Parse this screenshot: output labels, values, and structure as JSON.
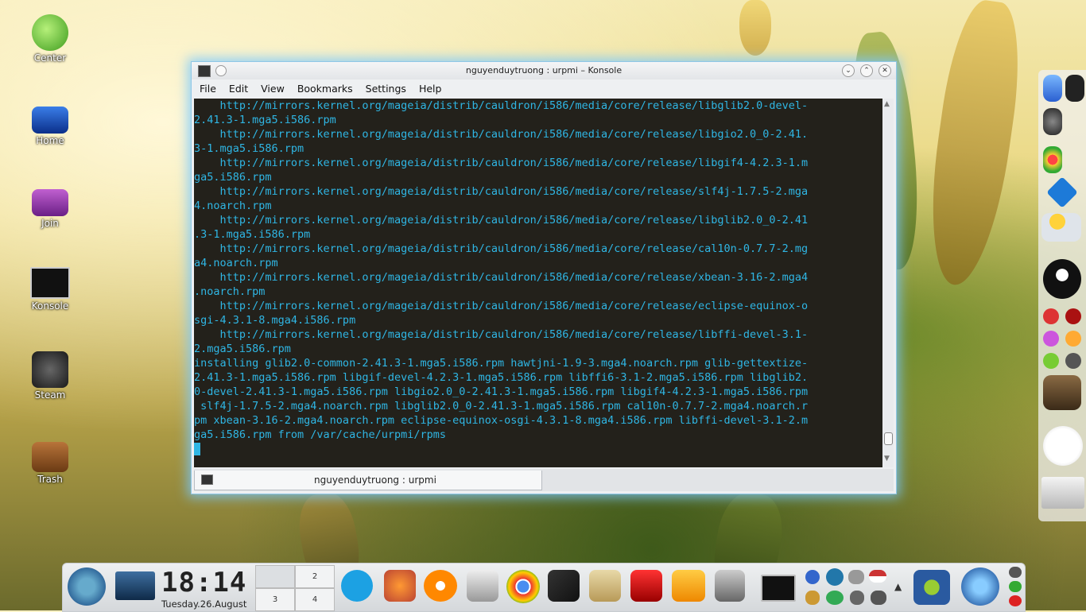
{
  "window": {
    "title": "nguyenduytruong : urpmi – Konsole",
    "menu": [
      "File",
      "Edit",
      "View",
      "Bookmarks",
      "Settings",
      "Help"
    ],
    "tab_label": "nguyenduytruong : urpmi"
  },
  "terminal": {
    "lines": [
      "    http://mirrors.kernel.org/mageia/distrib/cauldron/i586/media/core/release/libglib2.0-devel-",
      "2.41.3-1.mga5.i586.rpm",
      "    http://mirrors.kernel.org/mageia/distrib/cauldron/i586/media/core/release/libgio2.0_0-2.41.",
      "3-1.mga5.i586.rpm",
      "    http://mirrors.kernel.org/mageia/distrib/cauldron/i586/media/core/release/libgif4-4.2.3-1.m",
      "ga5.i586.rpm",
      "    http://mirrors.kernel.org/mageia/distrib/cauldron/i586/media/core/release/slf4j-1.7.5-2.mga",
      "4.noarch.rpm",
      "    http://mirrors.kernel.org/mageia/distrib/cauldron/i586/media/core/release/libglib2.0_0-2.41",
      ".3-1.mga5.i586.rpm",
      "    http://mirrors.kernel.org/mageia/distrib/cauldron/i586/media/core/release/cal10n-0.7.7-2.mg",
      "a4.noarch.rpm",
      "    http://mirrors.kernel.org/mageia/distrib/cauldron/i586/media/core/release/xbean-3.16-2.mga4",
      ".noarch.rpm",
      "    http://mirrors.kernel.org/mageia/distrib/cauldron/i586/media/core/release/eclipse-equinox-o",
      "sgi-4.3.1-8.mga4.i586.rpm",
      "    http://mirrors.kernel.org/mageia/distrib/cauldron/i586/media/core/release/libffi-devel-3.1-",
      "2.mga5.i586.rpm",
      "installing glib2.0-common-2.41.3-1.mga5.i586.rpm hawtjni-1.9-3.mga4.noarch.rpm glib-gettextize-",
      "2.41.3-1.mga5.i586.rpm libgif-devel-4.2.3-1.mga5.i586.rpm libffi6-3.1-2.mga5.i586.rpm libglib2.",
      "0-devel-2.41.3-1.mga5.i586.rpm libgio2.0_0-2.41.3-1.mga5.i586.rpm libgif4-4.2.3-1.mga5.i586.rpm",
      " slf4j-1.7.5-2.mga4.noarch.rpm libglib2.0_0-2.41.3-1.mga5.i586.rpm cal10n-0.7.7-2.mga4.noarch.r",
      "pm xbean-3.16-2.mga4.noarch.rpm eclipse-equinox-osgi-4.3.1-8.mga4.i586.rpm libffi-devel-3.1-2.m",
      "ga5.i586.rpm from /var/cache/urpmi/rpms"
    ],
    "text_color": "#2fb6e4",
    "background": "#23211b"
  },
  "desktop_icons": [
    "Center",
    "Home",
    "Join",
    "Konsole",
    "Steam",
    "Trash"
  ],
  "panel": {
    "time": "18:14",
    "date": "Tuesday.26.August",
    "pager": [
      "",
      "2",
      "3",
      "4"
    ]
  }
}
